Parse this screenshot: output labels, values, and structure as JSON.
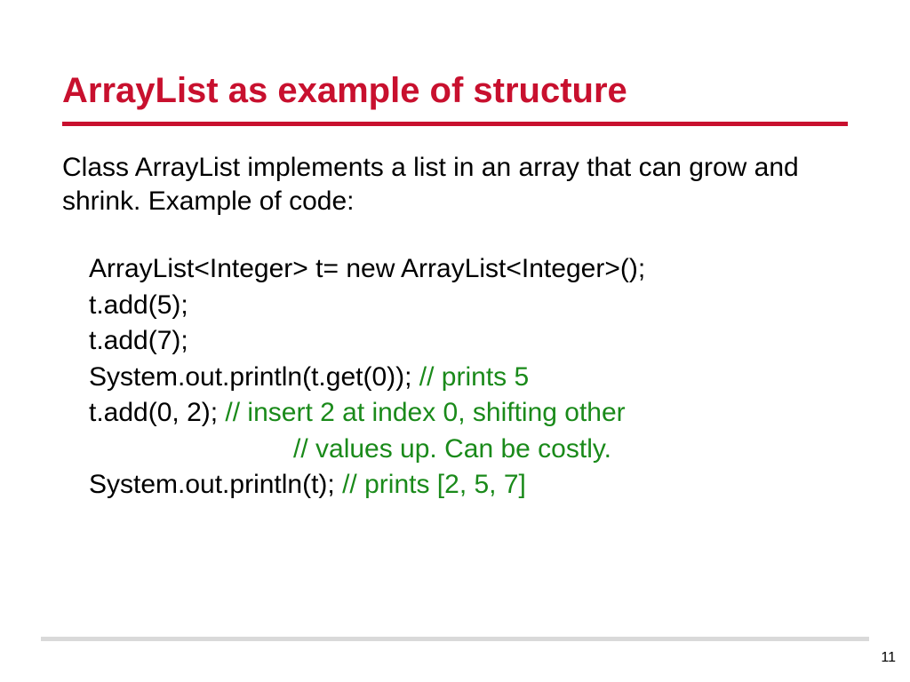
{
  "title": "ArrayList as example of structure",
  "intro": "Class ArrayList implements a list in an array that can grow and shrink. Example of code:",
  "code": {
    "l1": "ArrayList<Integer> t= new ArrayList<Integer>();",
    "l2": "t.add(5);",
    "l3": "t.add(7);",
    "l4a": "System.out.println(t.get(0));  ",
    "l4b": "// prints 5",
    "l5a": "t.add(0, 2);    ",
    "l5b": "// insert 2 at index 0, shifting other",
    "l6": "// values up. Can be costly.",
    "l7a": "System.out.println(t);   ",
    "l7b": "// prints [2, 5, 7]"
  },
  "pageNumber": "11"
}
